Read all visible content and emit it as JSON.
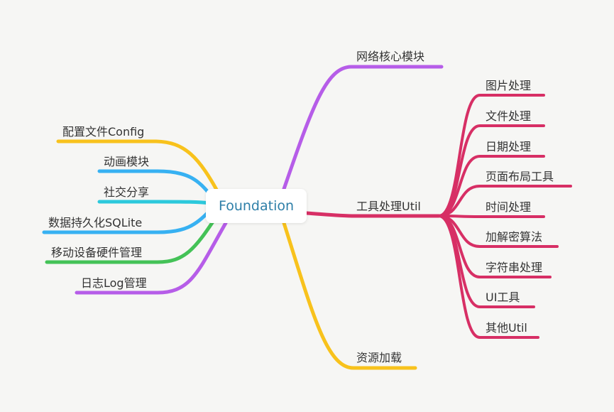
{
  "root": {
    "label": "Foundation"
  },
  "left_branches": [
    {
      "label": "配置文件Config",
      "color": "#f8c21c"
    },
    {
      "label": "动画模块",
      "color": "#37b1f2"
    },
    {
      "label": "社交分享",
      "color": "#2cc9dc"
    },
    {
      "label": "数据持久化SQLite",
      "color": "#37b1f2"
    },
    {
      "label": "移动设备硬件管理",
      "color": "#44c257"
    },
    {
      "label": "日志Log管理",
      "color": "#b65de8"
    }
  ],
  "right_branches": [
    {
      "label": "网络核心模块",
      "color": "#b65de8"
    },
    {
      "label": "工具处理Util",
      "color": "#d72f65",
      "children": [
        {
          "label": "图片处理"
        },
        {
          "label": "文件处理"
        },
        {
          "label": "日期处理"
        },
        {
          "label": "页面布局工具"
        },
        {
          "label": "时间处理"
        },
        {
          "label": "加解密算法"
        },
        {
          "label": "字符串处理"
        },
        {
          "label": "UI工具"
        },
        {
          "label": "其他Util"
        }
      ]
    },
    {
      "label": "资源加载",
      "color": "#f8c21c"
    }
  ]
}
